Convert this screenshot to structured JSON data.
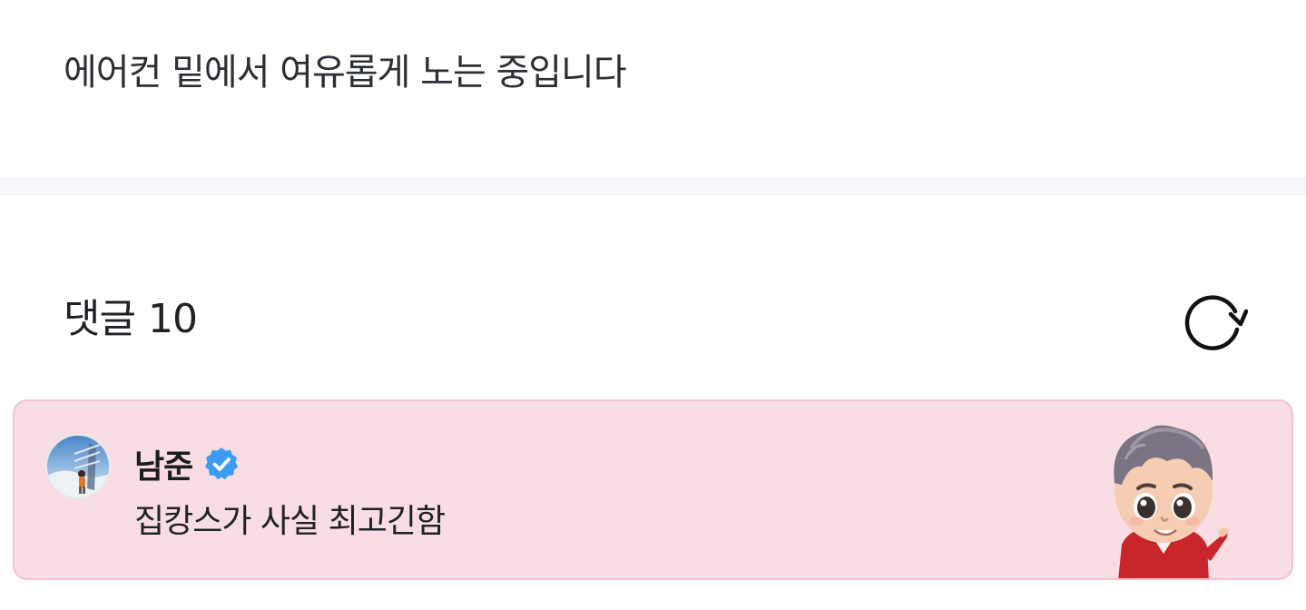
{
  "post": {
    "text": "에어컨 밑에서 여유롭게 노는 중입니다"
  },
  "comments": {
    "title": "댓글",
    "count": "10",
    "refresh_icon": "refresh-icon",
    "items": [
      {
        "author": "남준",
        "verified": true,
        "text": "집캉스가 사실 최고긴함",
        "sticker_icon": "character-sticker",
        "card_background": "#f9dde4"
      }
    ]
  },
  "colors": {
    "divider": "#f5f6f9",
    "card_background": "#f9dde4",
    "card_border": "#efc4cf",
    "verified_badge": "#3d9bf0"
  }
}
